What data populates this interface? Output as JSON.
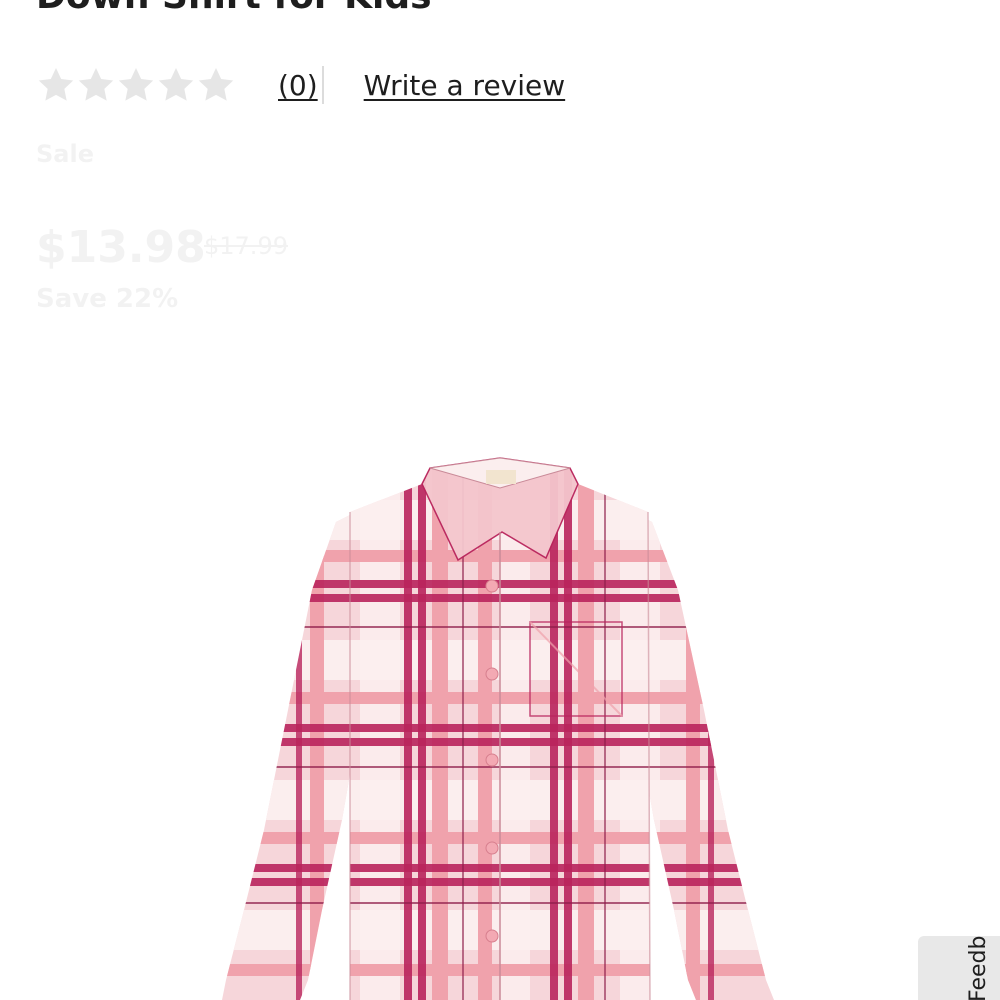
{
  "product": {
    "title": "Down Shirt for Kids"
  },
  "rating": {
    "stars_filled": 0,
    "stars_total": 5,
    "count_label": "(0)",
    "write_review_label": "Write a review"
  },
  "faded": {
    "badge": "Sale",
    "price": "$13.98",
    "was_price": "$17.99",
    "save": "Save 22%"
  },
  "image": {
    "icon": "plaid-shirt-image",
    "colors": {
      "base": "#f6d6da",
      "light": "#fbeeee",
      "pink": "#f0a2ac",
      "magenta": "#b9245c",
      "button": "#f3a9b3"
    }
  },
  "feedback_tab": {
    "label": "Feedback"
  }
}
